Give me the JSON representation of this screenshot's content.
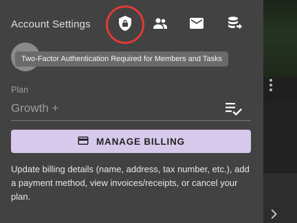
{
  "header": {
    "title": "Account Settings",
    "icons": [
      "shield-lock-icon",
      "people-icon",
      "mail-icon",
      "database-transfer-icon"
    ]
  },
  "tooltip": {
    "text": "Two-Factor Authentication Required for Members and Tasks"
  },
  "plan": {
    "label": "Plan",
    "value": "Growth +",
    "icon": "list-check-icon"
  },
  "billing": {
    "button_label": "MANAGE BILLING",
    "icon": "credit-card-icon",
    "description": "Update billing details (name, address, tax number, etc.), add a payment method, view invoices/receipts, or cancel your plan."
  },
  "colors": {
    "panel_bg": "#424242",
    "button_bg": "#d7c9ec",
    "active_ring": "#e53935",
    "tooltip_bg": "#6a6a6a"
  }
}
